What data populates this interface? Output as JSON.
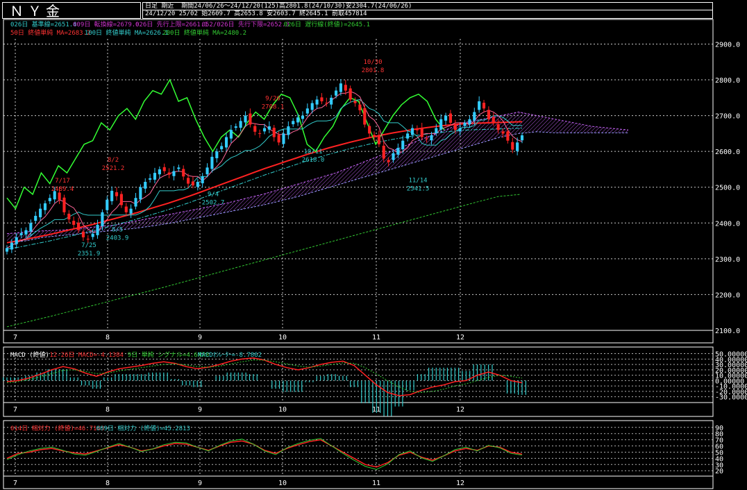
{
  "title": "ＮＹ金",
  "header": {
    "period_label": "日足 期近",
    "range": "期間24/06/26～24/12/20(125)高2801.8(24/10/30)安2304.7(24/06/26)",
    "ohlc": "24/12/20 25/02 始2609.7 高2653.8 安2603.7 終2645.1 前取457814"
  },
  "legend": {
    "line1": [
      {
        "text": "026日 基準線=2651.4",
        "color": "#33cccc"
      },
      {
        "text": "009日 転換線=2679.0",
        "color": "#cc33cc"
      },
      {
        "text": "026日 先行上限=2661.1",
        "color": "#cc33cc"
      },
      {
        "text": "052/026日 先行下限=2652.3",
        "color": "#cc33cc"
      },
      {
        "text": "026日 遅行線(終値)=2645.1",
        "color": "#33cc33"
      }
    ],
    "line2": [
      {
        "text": "50日 終値単純 MA=2683.2",
        "color": "#ff3333"
      },
      {
        "text": "100日 終値単純 MA=2626.1",
        "color": "#33cccc"
      },
      {
        "text": "200日 終値単純 MA=2480.2",
        "color": "#33cc33"
      }
    ]
  },
  "macd_legend": [
    {
      "text": "MACD (終値)",
      "color": "#ffffff"
    },
    {
      "text": "12-26日 MACD=-4.1384",
      "color": "#ff3333"
    },
    {
      "text": "9日 単純 シグナル=4.6478",
      "color": "#33cc33"
    },
    {
      "text": "MACDｵｼﾚｰﾀｰ=-8.7862",
      "color": "#33cccc"
    }
  ],
  "rsi_legend": [
    {
      "text": "014日 相対力 (終値)=46.7143",
      "color": "#ff3333"
    },
    {
      "text": "009日 相対力 (終値)=45.2813",
      "color": "#33cccc"
    }
  ],
  "colors": {
    "bg": "#000000",
    "up": "#33ccff",
    "down": "#ff2222",
    "grid": "#ffffff",
    "ma50": "#ff2222",
    "ma200": "#33cc33",
    "chikou": "#33ff33",
    "kumo": "#cc66ff"
  },
  "chart_data": [
    {
      "type": "candlestick",
      "panel": "price",
      "x_tick_labels": [
        "7",
        "8",
        "9",
        "10",
        "11",
        "12"
      ],
      "y_ticks": [
        2100,
        2200,
        2300,
        2400,
        2500,
        2600,
        2700,
        2800,
        2900
      ],
      "ylim": [
        2100,
        2930
      ],
      "annotations": [
        {
          "text": "10/30",
          "value": 2801.8,
          "color": "#ff3333"
        },
        {
          "text": "2801.8",
          "value": 2801.8,
          "color": "#ff3333"
        },
        {
          "text": "9/26",
          "value": 2708.1,
          "color": "#ff3333"
        },
        {
          "text": "2708.1",
          "value": 2708.1,
          "color": "#ff3333"
        },
        {
          "text": "8/2",
          "value": 2521.2,
          "color": "#ff3333"
        },
        {
          "text": "2521.2",
          "value": 2521.2,
          "color": "#ff3333"
        },
        {
          "text": "7/17",
          "value": 2489.4,
          "color": "#ff3333"
        },
        {
          "text": "2489.4",
          "value": 2489.4,
          "color": "#ff3333"
        },
        {
          "text": "9/4",
          "value": 2502.7,
          "color": "#33cccc"
        },
        {
          "text": "2502.7",
          "value": 2502.7,
          "color": "#33cccc"
        },
        {
          "text": "8/5",
          "value": 2403.9,
          "color": "#33cccc"
        },
        {
          "text": "2403.9",
          "value": 2403.9,
          "color": "#33cccc"
        },
        {
          "text": "7/25",
          "value": 2351.9,
          "color": "#33cccc"
        },
        {
          "text": "2351.9",
          "value": 2351.9,
          "color": "#33cccc"
        },
        {
          "text": "10/11",
          "value": 2618.0,
          "color": "#33cccc"
        },
        {
          "text": "2618.0",
          "value": 2618.0,
          "color": "#33cccc"
        },
        {
          "text": "11/14",
          "value": 2541.5,
          "color": "#33cccc"
        },
        {
          "text": "2541.5",
          "value": 2541.5,
          "color": "#33cccc"
        }
      ],
      "closes": [
        2330,
        2345,
        2360,
        2372,
        2380,
        2400,
        2420,
        2440,
        2455,
        2470,
        2489,
        2465,
        2430,
        2410,
        2395,
        2380,
        2360,
        2355,
        2370,
        2395,
        2430,
        2465,
        2490,
        2475,
        2450,
        2430,
        2440,
        2470,
        2500,
        2515,
        2525,
        2540,
        2550,
        2545,
        2535,
        2545,
        2555,
        2530,
        2510,
        2505,
        2515,
        2530,
        2555,
        2585,
        2600,
        2615,
        2640,
        2660,
        2670,
        2685,
        2700,
        2675,
        2655,
        2650,
        2665,
        2670,
        2640,
        2625,
        2650,
        2670,
        2685,
        2695,
        2700,
        2720,
        2735,
        2745,
        2740,
        2735,
        2750,
        2770,
        2790,
        2770,
        2745,
        2735,
        2715,
        2675,
        2650,
        2640,
        2620,
        2580,
        2570,
        2595,
        2610,
        2630,
        2650,
        2665,
        2660,
        2640,
        2635,
        2645,
        2665,
        2690,
        2700,
        2680,
        2660,
        2665,
        2680,
        2690,
        2710,
        2740,
        2720,
        2690,
        2680,
        2660,
        2650,
        2630,
        2605,
        2625,
        2645
      ],
      "ma50": [
        2345,
        2350,
        2356,
        2362,
        2368,
        2375,
        2382,
        2389,
        2396,
        2404,
        2412,
        2420,
        2428,
        2437,
        2446,
        2455,
        2465,
        2475,
        2486,
        2497,
        2508,
        2519,
        2530,
        2541,
        2552,
        2562,
        2572,
        2582,
        2592,
        2601,
        2610,
        2618,
        2626,
        2633,
        2640,
        2646,
        2652,
        2657,
        2662,
        2666,
        2670,
        2673,
        2676,
        2678,
        2679,
        2680,
        2681,
        2682,
        2683
      ],
      "ma200": [
        2110,
        2125,
        2140,
        2156,
        2172,
        2188,
        2204,
        2220,
        2237,
        2254,
        2271,
        2288,
        2305,
        2322,
        2339,
        2356,
        2373,
        2390,
        2407,
        2424,
        2441,
        2458,
        2474,
        2480
      ],
      "chikou": [
        2470,
        2440,
        2500,
        2480,
        2540,
        2510,
        2560,
        2540,
        2580,
        2620,
        2630,
        2680,
        2660,
        2700,
        2720,
        2690,
        2740,
        2770,
        2760,
        2800,
        2740,
        2750,
        2690,
        2640,
        2600,
        2640,
        2660,
        2640,
        2680,
        2710,
        2690,
        2730,
        2760,
        2750,
        2700,
        2620,
        2600,
        2640,
        2670,
        2720,
        2750,
        2740,
        2680,
        2620,
        2660,
        2700,
        2730,
        2750,
        2760,
        2740,
        2690,
        2660
      ],
      "kumo_upper": [
        2370,
        2375,
        2378,
        2380,
        2385,
        2390,
        2395,
        2405,
        2415,
        2425,
        2435,
        2445,
        2455,
        2468,
        2480,
        2495,
        2510,
        2525,
        2540,
        2560,
        2580,
        2600,
        2620,
        2640,
        2660,
        2680,
        2690,
        2700,
        2710,
        2700,
        2690,
        2680,
        2670,
        2665,
        2660
      ],
      "kumo_lower": [
        2345,
        2350,
        2360,
        2365,
        2370,
        2375,
        2380,
        2385,
        2392,
        2400,
        2410,
        2420,
        2430,
        2440,
        2450,
        2462,
        2475,
        2490,
        2505,
        2520,
        2535,
        2550,
        2565,
        2580,
        2595,
        2610,
        2625,
        2640,
        2650,
        2655,
        2652,
        2652,
        2652,
        2652,
        2652
      ]
    },
    {
      "type": "line",
      "panel": "macd",
      "y_tick_labels": [
        "50.00000",
        "40.00000",
        "30.00000",
        "20.00000",
        "10.00000",
        "0.00000",
        "-10.00000",
        "-20.00000",
        "-30.00000"
      ],
      "ylim": [
        -33,
        52
      ],
      "series": [
        {
          "name": "12-26日 MACD",
          "values": [
            -2,
            0,
            5,
            12,
            20,
            26,
            22,
            14,
            8,
            16,
            22,
            25,
            28,
            32,
            35,
            32,
            26,
            22,
            25,
            30,
            36,
            40,
            42,
            38,
            30,
            24,
            20,
            24,
            30,
            34,
            36,
            28,
            10,
            -8,
            -22,
            -28,
            -26,
            -18,
            -12,
            -8,
            -2,
            0,
            10,
            16,
            10,
            0,
            -4
          ]
        },
        {
          "name": "9日 単純 シグナル",
          "values": [
            -4,
            -2,
            2,
            7,
            13,
            19,
            20,
            17,
            13,
            14,
            18,
            21,
            24,
            27,
            30,
            31,
            29,
            26,
            25,
            27,
            31,
            35,
            38,
            38,
            35,
            31,
            27,
            25,
            27,
            30,
            33,
            32,
            24,
            12,
            0,
            -12,
            -20,
            -22,
            -20,
            -16,
            -10,
            -6,
            0,
            6,
            10,
            8,
            4.6
          ]
        },
        {
          "name": "MACDｵｼﾚｰﾀｰ",
          "values": [
            2,
            2,
            3,
            5,
            7,
            7,
            2,
            -3,
            -5,
            2,
            4,
            4,
            4,
            5,
            5,
            1,
            -3,
            -4,
            0,
            3,
            5,
            5,
            4,
            0,
            -5,
            -7,
            -7,
            -1,
            3,
            4,
            3,
            -4,
            -14,
            -20,
            -22,
            -16,
            -6,
            4,
            8,
            8,
            8,
            6,
            10,
            10,
            0,
            -8,
            -8.8
          ]
        }
      ]
    },
    {
      "type": "line",
      "panel": "rsi",
      "y_tick_labels": [
        "90",
        "80",
        "70",
        "60",
        "50",
        "40",
        "30",
        "20"
      ],
      "ylim": [
        18,
        92
      ],
      "series": [
        {
          "name": "014日 相対力 (終値)",
          "values": [
            40,
            48,
            50,
            54,
            56,
            52,
            49,
            47,
            52,
            57,
            62,
            58,
            52,
            55,
            60,
            64,
            63,
            58,
            53,
            60,
            66,
            68,
            63,
            53,
            48,
            56,
            62,
            67,
            70,
            60,
            50,
            40,
            30,
            26,
            33,
            45,
            50,
            42,
            37,
            44,
            52,
            56,
            53,
            60,
            58,
            50,
            46.7
          ]
        },
        {
          "name": "009日 相対力 (終値)",
          "values": [
            38,
            46,
            52,
            56,
            58,
            53,
            47,
            45,
            51,
            58,
            64,
            58,
            51,
            55,
            62,
            66,
            65,
            58,
            52,
            61,
            68,
            71,
            63,
            52,
            46,
            57,
            64,
            69,
            72,
            60,
            48,
            37,
            27,
            22,
            31,
            46,
            52,
            41,
            35,
            44,
            54,
            58,
            52,
            61,
            57,
            48,
            45.3
          ]
        }
      ]
    }
  ]
}
